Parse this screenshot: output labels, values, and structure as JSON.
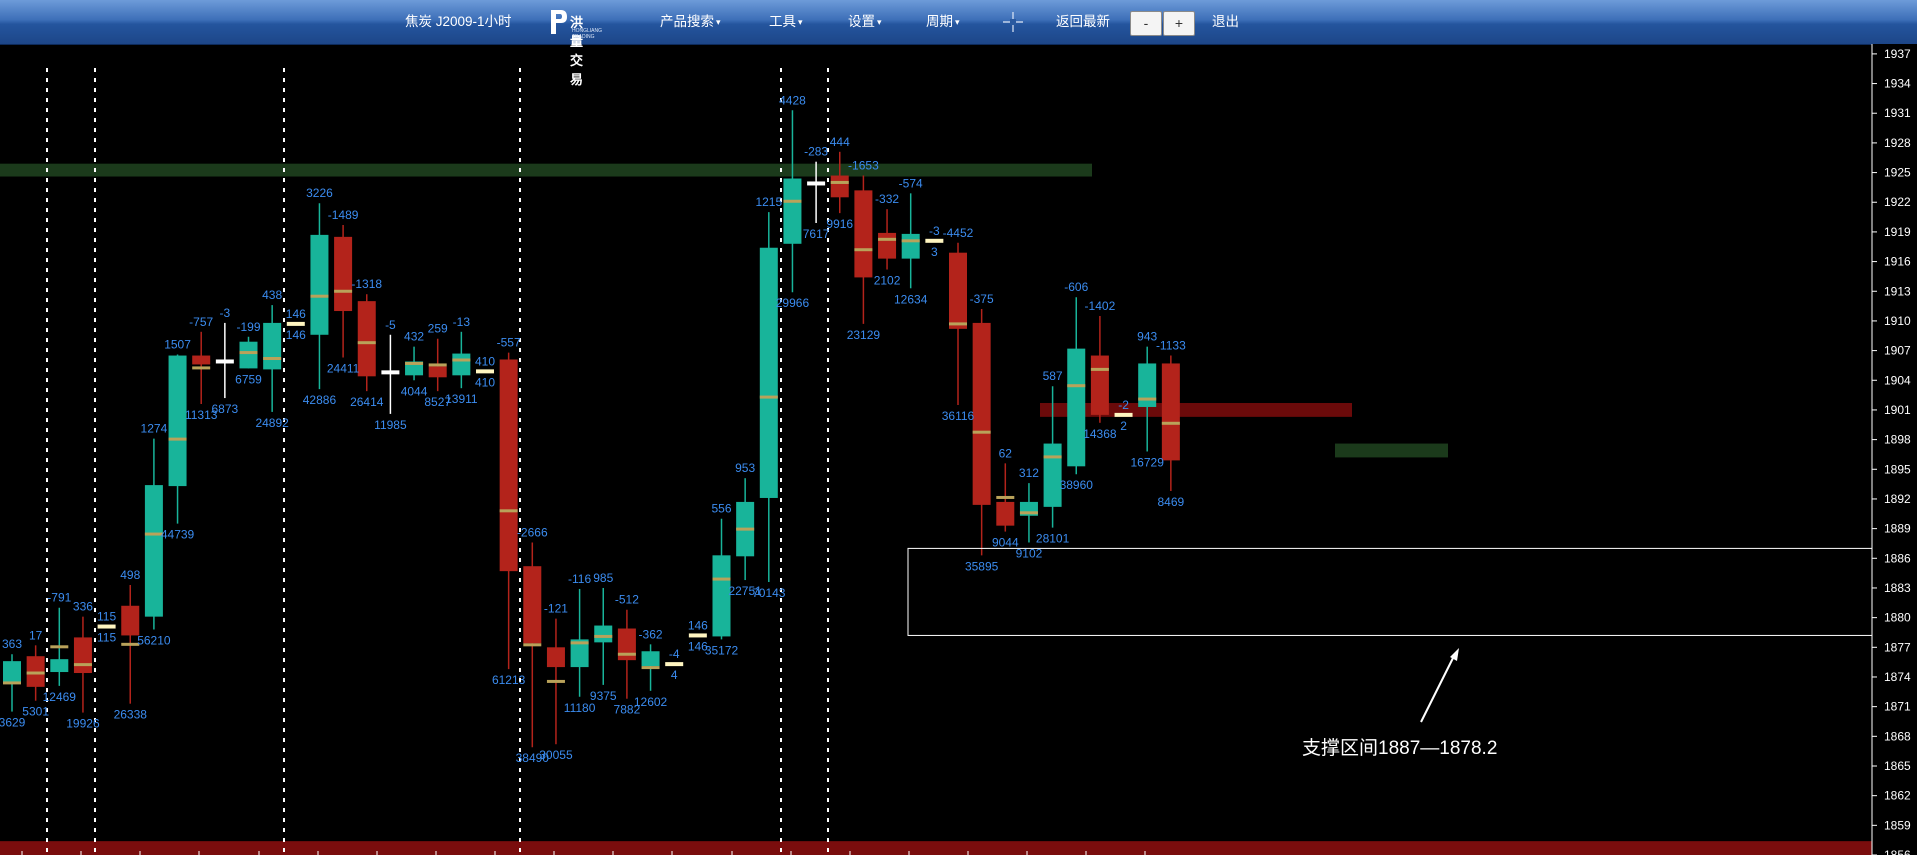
{
  "toolbar": {
    "symbol": "焦炭 J2009-1小时",
    "logo_text": "洪量交易",
    "logo_sub": "HONGLIANG TRADING",
    "menu_search": "产品搜索",
    "menu_tools": "工具",
    "menu_settings": "设置",
    "menu_period": "周期",
    "back_latest": "返回最新",
    "zoom_out": "-",
    "zoom_in": "+",
    "exit": "退出",
    "dropdown_caret": "▾"
  },
  "annotation": {
    "text": "支撑区间1887—1878.2"
  },
  "colors": {
    "up": "#18b49a",
    "down": "#b3231b",
    "marker": "#b9a25a",
    "neutral": "#ffffff",
    "label": "#3b8cf0",
    "support_box": "#ffffff",
    "resist_green": "#1b3a1b",
    "red_band": "#6b0a0a",
    "bottom_band": "#7a0d0d"
  },
  "chart_data": {
    "type": "candlestick",
    "ylim": [
      1856,
      1938
    ],
    "y_ticks": [
      1937,
      1934,
      1931,
      1928,
      1925,
      1922,
      1919,
      1916,
      1913,
      1910,
      1907,
      1904,
      1901,
      1898,
      1895,
      1892,
      1889,
      1886,
      1883,
      1880,
      1877,
      1874,
      1871,
      1868,
      1865,
      1862,
      1859,
      1856
    ],
    "session_breaks": [
      1,
      3,
      11,
      21,
      32,
      34
    ],
    "zones": [
      {
        "kind": "resistance",
        "from": 1924.6,
        "to": 1925.9
      },
      {
        "kind": "red",
        "from": 1900.3,
        "to": 1901.7
      },
      {
        "kind": "green",
        "from": 1896.2,
        "to": 1897.6
      },
      {
        "kind": "bottom",
        "from": 1856.0,
        "to": 1857.4
      }
    ],
    "support_zone": {
      "low": 1878.2,
      "high": 1887
    },
    "candles": [
      {
        "o": 1873.4,
        "h": 1876.3,
        "l": 1870.5,
        "c": 1875.6,
        "tag": "363",
        "tag2": "3629"
      },
      {
        "o": 1876.1,
        "h": 1877.2,
        "l": 1871.6,
        "c": 1873.0,
        "tag": "17",
        "tag2": "5301"
      },
      {
        "o": 1874.5,
        "h": 1881.0,
        "l": 1873.1,
        "c": 1875.8,
        "tag": "-791",
        "tag2": "12469"
      },
      {
        "o": 1878.0,
        "h": 1880.1,
        "l": 1870.4,
        "c": 1874.4,
        "tag": "336",
        "tag2": "19926"
      },
      {
        "o": 1879.1,
        "h": 1879.1,
        "l": 1879.1,
        "c": 1879.1,
        "tag": "115",
        "tag2": "115",
        "doji": true
      },
      {
        "o": 1881.2,
        "h": 1883.3,
        "l": 1871.3,
        "c": 1878.2,
        "tag": "498",
        "tag2": "26338"
      },
      {
        "o": 1880.1,
        "h": 1898.1,
        "l": 1878.8,
        "c": 1893.4,
        "tag": "1274",
        "tag2": "56210"
      },
      {
        "o": 1893.3,
        "h": 1906.6,
        "l": 1889.5,
        "c": 1906.5,
        "tag": "1507",
        "tag2": "44739"
      },
      {
        "o": 1906.5,
        "h": 1908.9,
        "l": 1901.6,
        "c": 1905.6,
        "tag": "-757",
        "tag2": "11313"
      },
      {
        "o": 1905.9,
        "h": 1909.8,
        "l": 1902.2,
        "c": 1905.9,
        "tag": "-3",
        "tag2": "6873",
        "doji": true
      },
      {
        "o": 1905.2,
        "h": 1908.4,
        "l": 1905.2,
        "c": 1907.9,
        "tag": "-199",
        "tag2": "6759"
      },
      {
        "o": 1905.1,
        "h": 1911.6,
        "l": 1900.8,
        "c": 1909.8,
        "tag": "438",
        "tag2": "24892"
      },
      {
        "o": 1909.7,
        "h": 1909.7,
        "l": 1909.7,
        "c": 1909.7,
        "tag": "146",
        "tag2": "146",
        "doji": true
      },
      {
        "o": 1908.6,
        "h": 1921.9,
        "l": 1903.1,
        "c": 1918.7,
        "tag": "3226",
        "tag2": "42886"
      },
      {
        "o": 1918.5,
        "h": 1919.7,
        "l": 1906.3,
        "c": 1911.0,
        "tag": "-1489",
        "tag2": "24411"
      },
      {
        "o": 1912.0,
        "h": 1912.7,
        "l": 1902.9,
        "c": 1904.4,
        "tag": "-1318",
        "tag2": "26414"
      },
      {
        "o": 1904.8,
        "h": 1908.6,
        "l": 1900.6,
        "c": 1904.8,
        "tag": "-5",
        "tag2": "11985",
        "doji": true
      },
      {
        "o": 1904.5,
        "h": 1907.4,
        "l": 1904.0,
        "c": 1905.9,
        "tag": "432",
        "tag2": "4044"
      },
      {
        "o": 1905.4,
        "h": 1908.2,
        "l": 1902.9,
        "c": 1904.3,
        "tag": "259",
        "tag2": "8527"
      },
      {
        "o": 1904.5,
        "h": 1908.9,
        "l": 1903.2,
        "c": 1906.7,
        "tag": "-13",
        "tag2": "13911"
      },
      {
        "o": 1904.9,
        "h": 1904.9,
        "l": 1904.9,
        "c": 1904.9,
        "tag": "410",
        "tag2": "410",
        "doji": true
      },
      {
        "o": 1906.1,
        "h": 1906.8,
        "l": 1874.8,
        "c": 1884.7,
        "tag": "-557",
        "tag2": "61213"
      },
      {
        "o": 1885.2,
        "h": 1887.6,
        "l": 1866.9,
        "c": 1877.4,
        "tag": "-2666",
        "tag2": "38490"
      },
      {
        "o": 1877.0,
        "h": 1879.9,
        "l": 1867.2,
        "c": 1875.0,
        "tag": "-121",
        "tag2": "30055"
      },
      {
        "o": 1875.0,
        "h": 1882.9,
        "l": 1872.0,
        "c": 1877.8,
        "tag": "-116",
        "tag2": "11180"
      },
      {
        "o": 1877.5,
        "h": 1883.0,
        "l": 1873.2,
        "c": 1879.2,
        "tag": "985",
        "tag2": "9375"
      },
      {
        "o": 1878.9,
        "h": 1880.8,
        "l": 1871.8,
        "c": 1875.7,
        "tag": "-512",
        "tag2": "7882"
      },
      {
        "o": 1875.1,
        "h": 1877.3,
        "l": 1872.6,
        "c": 1876.6,
        "tag": "-362",
        "tag2": "12602"
      },
      {
        "o": 1875.3,
        "h": 1875.3,
        "l": 1875.3,
        "c": 1875.3,
        "tag": "-4",
        "tag2": "4",
        "doji": true
      },
      {
        "o": 1878.2,
        "h": 1878.2,
        "l": 1878.2,
        "c": 1878.2,
        "tag": "146",
        "tag2": "146",
        "doji": true
      },
      {
        "o": 1878.1,
        "h": 1890.0,
        "l": 1877.8,
        "c": 1886.3,
        "tag": "556",
        "tag2": "35172"
      },
      {
        "o": 1886.2,
        "h": 1894.1,
        "l": 1883.8,
        "c": 1891.7,
        "tag": "953",
        "tag2": "22751"
      },
      {
        "o": 1892.1,
        "h": 1921.0,
        "l": 1883.6,
        "c": 1917.4,
        "tag": "1215",
        "tag2": "70143"
      },
      {
        "o": 1917.8,
        "h": 1931.3,
        "l": 1912.9,
        "c": 1924.4,
        "tag": "4428",
        "tag2": "29966"
      },
      {
        "o": 1923.9,
        "h": 1926.1,
        "l": 1919.9,
        "c": 1923.9,
        "tag": "-283",
        "tag2": "7617",
        "doji": true
      },
      {
        "o": 1924.7,
        "h": 1927.1,
        "l": 1920.9,
        "c": 1922.5,
        "tag": "444",
        "tag2": "9916"
      },
      {
        "o": 1923.2,
        "h": 1924.7,
        "l": 1909.7,
        "c": 1914.4,
        "tag": "-1653",
        "tag2": "23129"
      },
      {
        "o": 1918.9,
        "h": 1921.3,
        "l": 1915.2,
        "c": 1916.3,
        "tag": "-332",
        "tag2": "2102"
      },
      {
        "o": 1916.3,
        "h": 1922.9,
        "l": 1913.3,
        "c": 1918.8,
        "tag": "-574",
        "tag2": "12634"
      },
      {
        "o": 1918.1,
        "h": 1918.1,
        "l": 1918.1,
        "c": 1918.1,
        "tag": "-3",
        "tag2": "3",
        "doji": true
      },
      {
        "o": 1916.9,
        "h": 1917.9,
        "l": 1901.5,
        "c": 1909.2,
        "tag": "-4452",
        "tag2": "36116"
      },
      {
        "o": 1909.8,
        "h": 1911.2,
        "l": 1886.3,
        "c": 1891.4,
        "tag": "-375",
        "tag2": "35895"
      },
      {
        "o": 1891.7,
        "h": 1895.6,
        "l": 1888.7,
        "c": 1889.3,
        "tag": "62",
        "tag2": "9044"
      },
      {
        "o": 1890.3,
        "h": 1893.6,
        "l": 1887.6,
        "c": 1891.7,
        "tag": "312",
        "tag2": "9102"
      },
      {
        "o": 1891.2,
        "h": 1903.4,
        "l": 1889.1,
        "c": 1897.6,
        "tag": "587",
        "tag2": "28101"
      },
      {
        "o": 1895.3,
        "h": 1912.4,
        "l": 1894.5,
        "c": 1907.2,
        "tag": "-606",
        "tag2": "38960"
      },
      {
        "o": 1906.5,
        "h": 1910.5,
        "l": 1899.7,
        "c": 1900.5,
        "tag": "-1402",
        "tag2": "14368"
      },
      {
        "o": 1900.5,
        "h": 1900.5,
        "l": 1900.5,
        "c": 1900.5,
        "tag": "-2",
        "tag2": "2",
        "doji": true
      },
      {
        "o": 1901.3,
        "h": 1907.4,
        "l": 1896.8,
        "c": 1905.7,
        "tag": "943",
        "tag2": "16729"
      },
      {
        "o": 1905.7,
        "h": 1906.5,
        "l": 1892.8,
        "c": 1895.9,
        "tag": "-1133",
        "tag2": "8469"
      }
    ]
  }
}
